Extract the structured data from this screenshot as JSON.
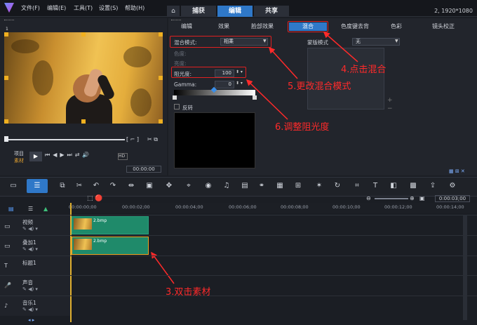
{
  "menu": [
    "文件(F)",
    "编辑(E)",
    "工具(T)",
    "设置(S)",
    "帮助(H)"
  ],
  "workspace_tabs": [
    "捕获",
    "编辑",
    "共享"
  ],
  "resolution": "2, 1920*1080",
  "preview": {
    "badge": "1",
    "project_label": "项目",
    "clip_label": "素材",
    "timecode": "00:00:00"
  },
  "subtabs": [
    "编辑",
    "效果",
    "脸部效果",
    "混合",
    "色度键去背",
    "色彩",
    "镜头校正"
  ],
  "blend": {
    "mode_label": "混合模式:",
    "mode_value": "相乘",
    "hue_label": "色度:",
    "sat_label": "亮度:",
    "opacity_label": "阻光度:",
    "opacity_value": "100",
    "gamma_label": "Gamma:",
    "gamma_value": "0",
    "invert_label": "反转",
    "mask_label": "蒙版模式",
    "mask_value": "无"
  },
  "annotations": {
    "a4": "4.点击混合",
    "a5": "5.更改混合模式",
    "a6": "6.调整阻光度",
    "a3": "3.双击素材"
  },
  "ruler": [
    "00:00:00;00",
    "00:00:02;00",
    "00:00:04;00",
    "00:00:06;00",
    "00:00:08;00",
    "00:00:10;00",
    "00:00:12;00",
    "00:00:14;00"
  ],
  "zoom_time": "0:00:03;00",
  "tracks": [
    {
      "name": "视频"
    },
    {
      "name": "叠加1"
    },
    {
      "name": "标题1"
    },
    {
      "name": "声音"
    },
    {
      "name": "音乐1"
    }
  ],
  "clips": [
    {
      "name": "2.bmp"
    },
    {
      "name": "2.bmp"
    }
  ]
}
